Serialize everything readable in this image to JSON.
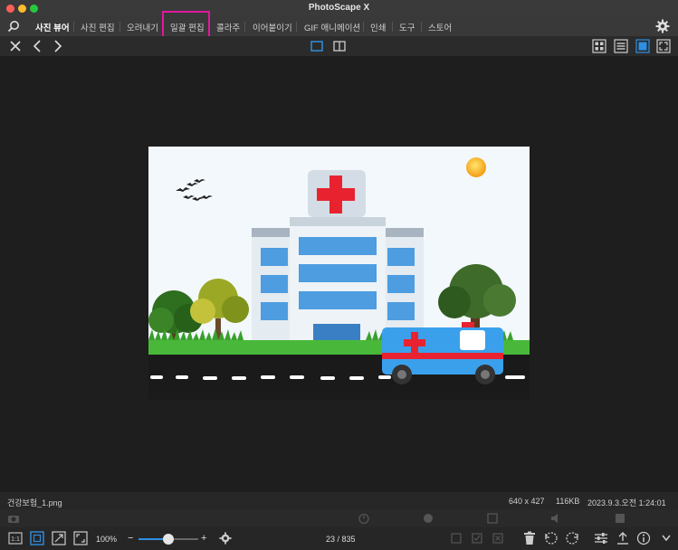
{
  "window": {
    "title": "PhotoScape X"
  },
  "tabs": [
    {
      "label": "사진 뷰어",
      "active": true
    },
    {
      "label": "사진 편집"
    },
    {
      "label": "오려내기"
    },
    {
      "label": "일괄 편집"
    },
    {
      "label": "콜라주"
    },
    {
      "label": "이어붙이기"
    },
    {
      "label": "GIF 애니메이션"
    },
    {
      "label": "인쇄"
    },
    {
      "label": "도구"
    },
    {
      "label": "스토어"
    }
  ],
  "file": {
    "name": "건강보험_1.png",
    "dimensions": "640 x 427",
    "size": "116KB",
    "date": "2023.9.3.오전 1:24:01"
  },
  "zoom": {
    "level": "100%",
    "slider_fraction": 0.5
  },
  "pager": {
    "text": "23 / 835"
  },
  "icons": {
    "home": "search-icon",
    "settings": "gear-icon"
  },
  "colors": {
    "accent": "#2f8fe0",
    "highlight": "#e0189c",
    "cross": "#e8232f"
  }
}
